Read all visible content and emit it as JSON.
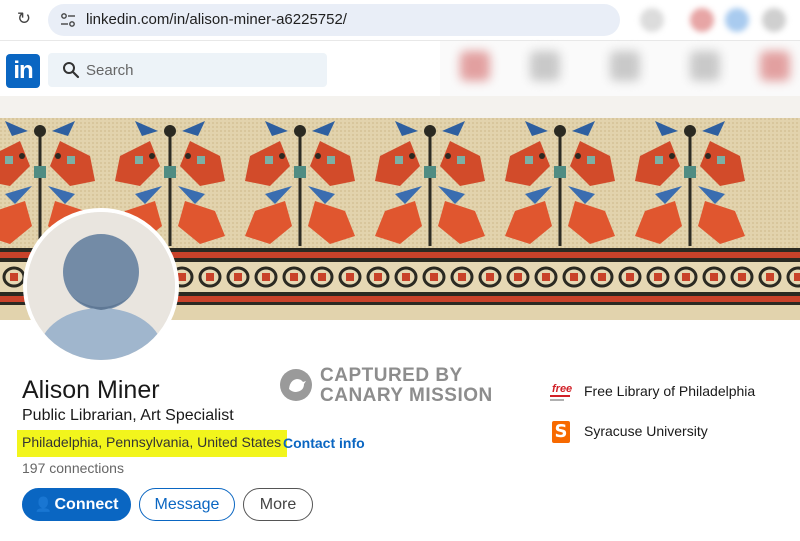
{
  "browser": {
    "url": "linkedin.com/in/alison-miner-a6225752/",
    "reload_icon": "reload-icon",
    "site_info_icon": "tune-icon"
  },
  "header": {
    "logo_text": "in",
    "search_placeholder": "Search"
  },
  "profile": {
    "name": "Alison Miner",
    "headline": "Public Librarian, Art Specialist",
    "location": "Philadelphia, Pennsylvania, United States",
    "contact_label": "Contact info",
    "connections": "197 connections"
  },
  "actions": {
    "connect_label": "Connect",
    "message_label": "Message",
    "more_label": "More"
  },
  "organizations": [
    {
      "name": "Free Library of Philadelphia",
      "logo_text": "free"
    },
    {
      "name": "Syracuse University",
      "logo_text": "S"
    }
  ],
  "watermark": {
    "line1": "CAPTURED BY",
    "line2": "CANARY MISSION"
  },
  "colors": {
    "linkedin_blue": "#0a66c2",
    "highlight": "#f2f51c",
    "syracuse_orange": "#f76900",
    "free_library_red": "#d12027"
  }
}
